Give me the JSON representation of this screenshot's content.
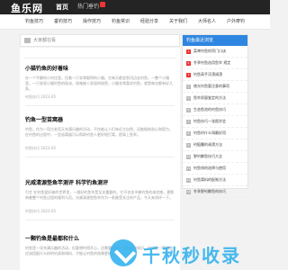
{
  "header": {
    "logo": "鱼乐网",
    "nav": [
      {
        "label": "首页",
        "active": true
      },
      {
        "label": "热门垂钓",
        "active": false,
        "badge": true
      },
      {
        "label": "",
        "active": false
      }
    ]
  },
  "subnav": {
    "items": [
      "钓鱼技巧",
      "垂钓技巧",
      "操作技巧",
      "钓鱼常识",
      "经验分享",
      "关于我们",
      "大师名人",
      "户外摩钓",
      "最新资讯"
    ]
  },
  "breadcrumb": "大家都在看",
  "main": {
    "section_title": "大家都在看",
    "articles": [
      {
        "title": "小猫钓鱼的好着味",
        "snippet": "在一个平静的小村庄里，住着一只非常聪明的小猫。它每天都会到河边去钓鱼，一整个小镇里，一只发现小猫钓鱼的秘诀，很难被人发现的秘密，小猫非常喜欢钓鱼，就是每次都有好几条。",
        "meta": "钓鱼技巧 2023-05"
      },
      {
        "title": "钓鱼一型苗窝器",
        "snippet": "钓鱼，作为一项古老而又充满乐趣的活动，不仅能让人们亲近大自然，还能锻炼耐心和毅力，在钓鱼的过程中，一型苗窝器可以帮助钓鱼人更好地打窝，提高上鱼率。",
        "meta": "钓鱼技巧 2023-05"
      },
      {
        "title": "光威清源垫鱼竿测评 科学钓鱼测评",
        "snippet": "引言 在钓鱼爱好者的世界里，一根好的鱼竿是至关重要的。它不仅关乎着钓鱼的体验感，更影响着整个钓鱼过程的顺利与否。光威清源垫鱼竿作为一款备受关注的产品，今天来测评一下。",
        "meta": "钓鱼技巧 2023-05"
      },
      {
        "title": "一颗钓鱼是最都和什么",
        "snippet": "钓鱼是一项充满乐趣的活动，但要想钓得开心，还需要了解一些基本的知识，比如说一颗钓鱼应该搭配什么样的钓具和饵料，才能让钓鱼的效果更好。",
        "meta": "钓鱼技巧 2023-05"
      }
    ]
  },
  "sidebar": {
    "title": "钓鱼最近浏览",
    "items": [
      {
        "num": "1",
        "label": "菜啤钓鱼的窍门口诀"
      },
      {
        "num": "2",
        "label": "冬季钓鱼选用鱼竿 规定"
      },
      {
        "num": "3",
        "label": "钓鱼高手浮漂调漂"
      },
      {
        "num": "4",
        "label": "夜光钓鱼要注意的事项"
      },
      {
        "num": "5",
        "label": "鱼竿质量鉴定的方法"
      },
      {
        "num": "6",
        "label": "生态鱼池的钓鱼技巧"
      },
      {
        "num": "7",
        "label": "钓鱼技巧一张图学会"
      },
      {
        "num": "8",
        "label": "钓鱼时什么饵最好用"
      },
      {
        "num": "9",
        "label": "钓鲢鳙的调漂方法"
      },
      {
        "num": "10",
        "label": "野钓鲫鱼技巧大全"
      },
      {
        "num": "11",
        "label": "钓鱼线的选择与使用"
      },
      {
        "num": "12",
        "label": "钓鱼窝料的配制方法"
      },
      {
        "num": "13",
        "label": "冬季野钓鲫鱼的技巧"
      }
    ]
  },
  "watermark": {
    "text": "千秋秒收录"
  },
  "colors": {
    "accent": "#2e86e0",
    "topbar": "#242424",
    "hot": "#e33333",
    "watermark": "#34b2ee"
  }
}
